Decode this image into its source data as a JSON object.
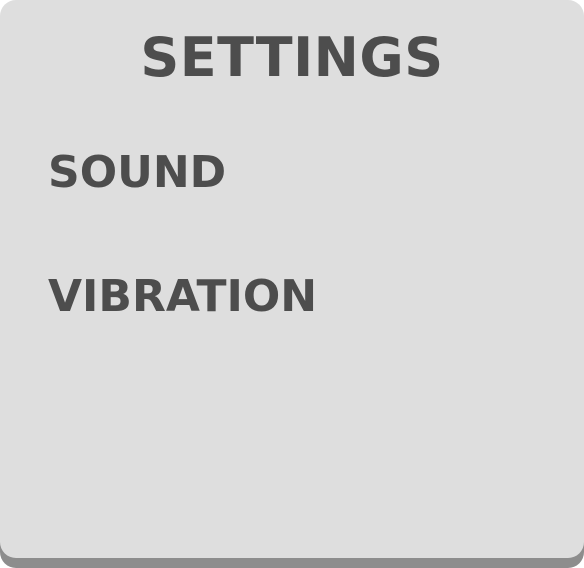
{
  "settings": {
    "title": "SETTINGS",
    "items": [
      {
        "label": "SOUND"
      },
      {
        "label": "VIBRATION"
      }
    ]
  },
  "colors": {
    "panel_background": "#dedede",
    "panel_shadow": "#8d8d8d",
    "text": "#4d4d4d"
  }
}
